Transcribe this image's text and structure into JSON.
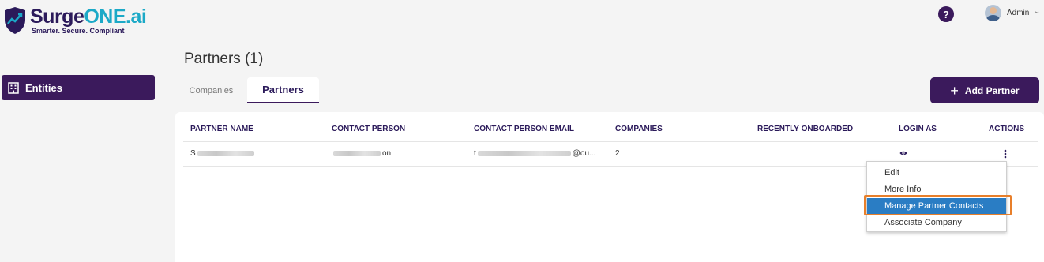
{
  "app": {
    "brand_prefix": "Surge",
    "brand_accent": "ONE.ai",
    "tagline": "Smarter. Secure. Compliant",
    "colors": {
      "primary": "#3b1a5c",
      "accent": "#1ba9c7",
      "highlight": "#2a7dc4",
      "focus": "#e87f2a"
    }
  },
  "header": {
    "help_label": "?",
    "user_name": "Admin",
    "user_chevron": "⌄"
  },
  "sidebar": {
    "items": [
      {
        "label": "Entities",
        "icon": "building-icon"
      }
    ]
  },
  "page": {
    "title": "Partners (1)",
    "tabs": [
      {
        "label": "Companies"
      },
      {
        "label": "Partners",
        "active": true
      }
    ],
    "add_button": {
      "plus": "+",
      "label": "Add Partner"
    }
  },
  "table": {
    "columns": [
      "PARTNER NAME",
      "CONTACT PERSON",
      "CONTACT PERSON EMAIL",
      "COMPANIES",
      "RECENTLY ONBOARDED",
      "LOGIN AS",
      "ACTIONS"
    ],
    "rows": [
      {
        "partner_prefix": "S",
        "contact_suffix": "on",
        "email_prefix": "t",
        "email_suffix": "@ou...",
        "companies": "2",
        "recently_onboarded": ""
      }
    ]
  },
  "actions_menu": {
    "items": [
      "Edit",
      "More Info",
      "Manage Partner Contacts",
      "Associate Company"
    ],
    "highlighted": "Manage Partner Contacts"
  }
}
